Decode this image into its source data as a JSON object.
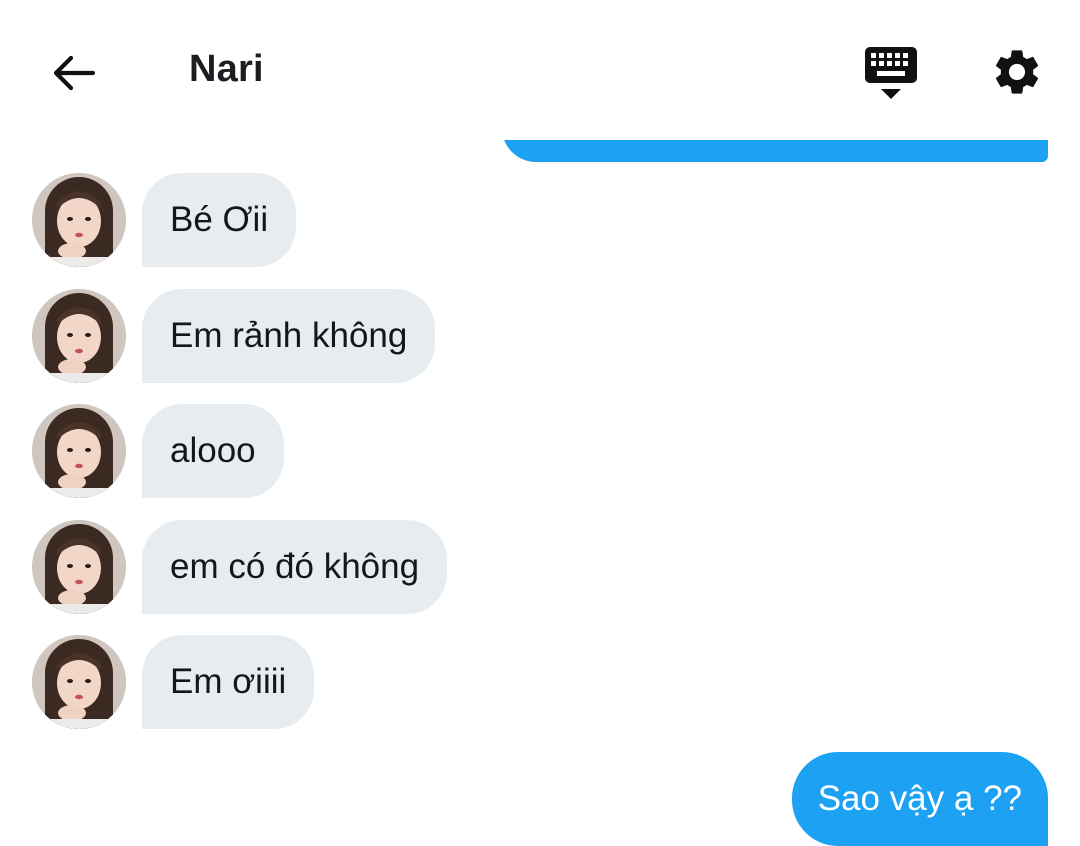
{
  "header": {
    "title": "Nari",
    "back_icon": "arrow-left-icon",
    "keyboard_icon": "keyboard-hide-icon",
    "settings_icon": "gear-icon"
  },
  "colors": {
    "accent": "#1da1f2",
    "incoming_bubble": "#e6ecf0",
    "text": "#14171a"
  },
  "messages": {
    "incoming": [
      {
        "text": "Bé Ơii"
      },
      {
        "text": "Em rảnh không"
      },
      {
        "text": "alooo"
      },
      {
        "text": "em có đó không"
      },
      {
        "text": "Em ơiiii"
      }
    ],
    "outgoing": [
      {
        "text": "Sao vậy ạ ??"
      }
    ]
  }
}
